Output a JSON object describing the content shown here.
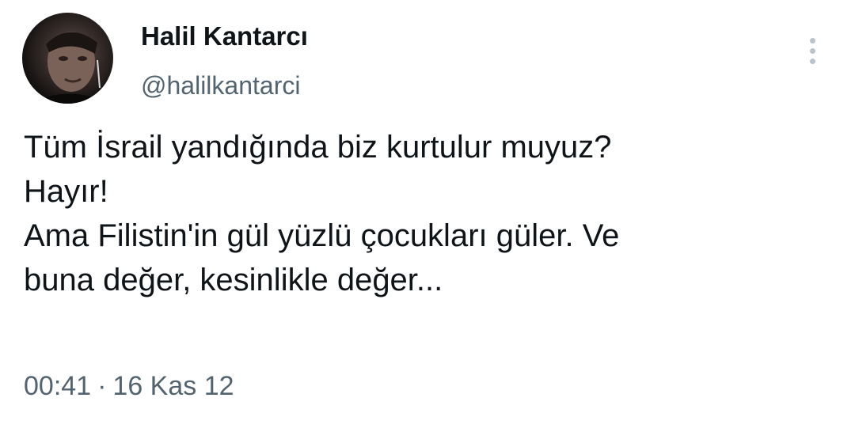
{
  "author": {
    "display_name": "Halil Kantarcı",
    "handle": "@halilkantarci",
    "avatar_icon": "user-photo"
  },
  "more_icon": "vertical-dots-icon",
  "tweet": {
    "lines": [
      "Tüm İsrail yandığında biz kurtulur muyuz?",
      "Hayır!",
      "Ama Filistin'in gül yüzlü çocukları güler. Ve",
      "buna değer, kesinlikle değer..."
    ]
  },
  "meta": {
    "time": "00:41",
    "separator": "·",
    "date": "16 Kas 12"
  },
  "colors": {
    "text": "#0f1419",
    "secondary": "#536471",
    "dots": "#b9c3cc"
  }
}
